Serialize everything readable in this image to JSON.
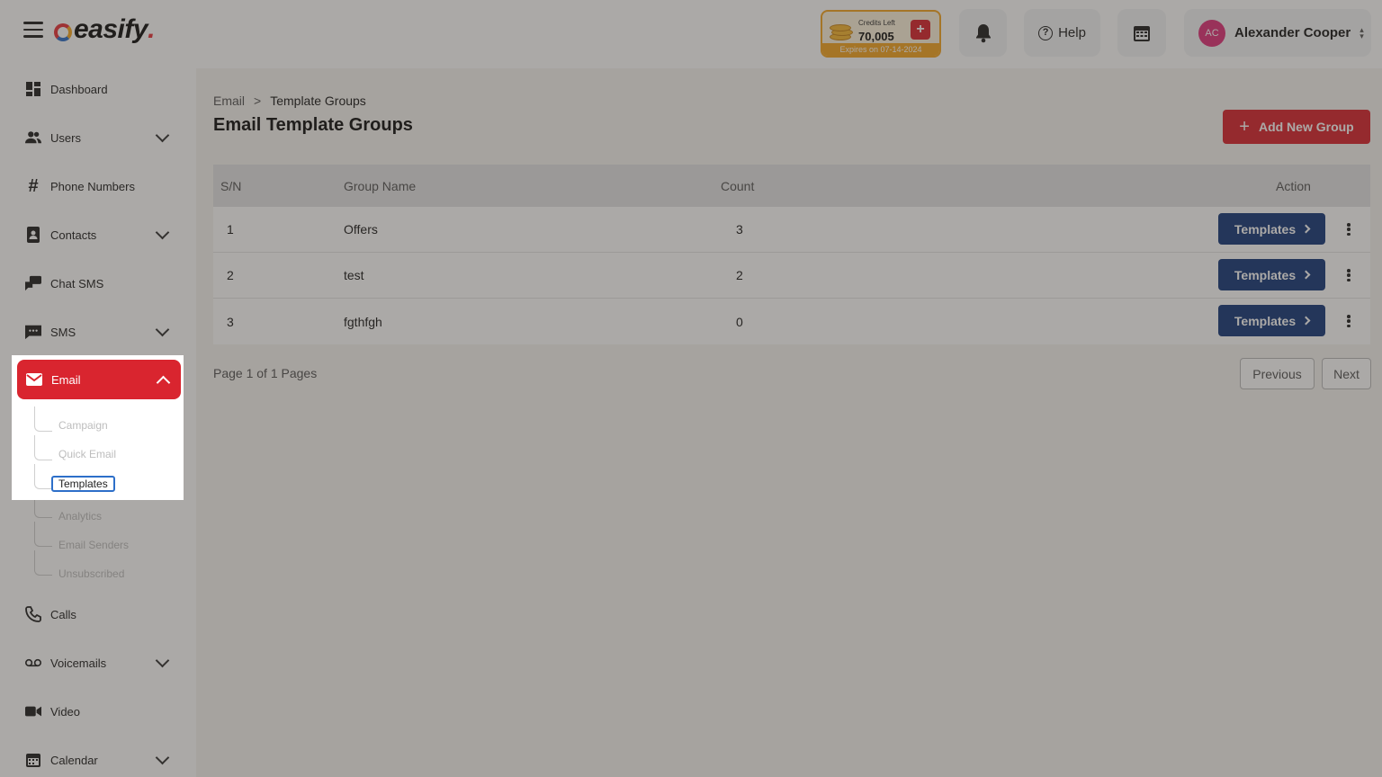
{
  "header": {
    "logo_text": "easify",
    "credits": {
      "label": "Credits Left",
      "amount": "70,005",
      "expires": "Expires on 07-14-2024",
      "add_symbol": "+"
    },
    "help_label": "Help",
    "user": {
      "initials": "AC",
      "name": "Alexander Cooper"
    },
    "colors": {
      "brand_red": "#d9252f",
      "credits_orange": "#f5a524",
      "avatar_pink": "#e0327a"
    }
  },
  "sidebar": {
    "items": [
      {
        "label": "Dashboard",
        "icon": "dashboard-icon",
        "expandable": false
      },
      {
        "label": "Users",
        "icon": "users-icon",
        "expandable": true
      },
      {
        "label": "Phone Numbers",
        "icon": "hash-icon",
        "expandable": false
      },
      {
        "label": "Contacts",
        "icon": "contacts-icon",
        "expandable": true
      },
      {
        "label": "Chat SMS",
        "icon": "chat-icon",
        "expandable": false
      },
      {
        "label": "SMS",
        "icon": "sms-icon",
        "expandable": true
      },
      {
        "label": "Email",
        "icon": "mail-icon",
        "expandable": true,
        "active": true
      },
      {
        "label": "Calls",
        "icon": "phone-icon",
        "expandable": false
      },
      {
        "label": "Voicemails",
        "icon": "voicemail-icon",
        "expandable": true
      },
      {
        "label": "Video",
        "icon": "video-icon",
        "expandable": false
      },
      {
        "label": "Calendar",
        "icon": "calendar-icon",
        "expandable": true
      }
    ],
    "email_subitems": [
      "Campaign",
      "Quick Email",
      "Templates",
      "Analytics",
      "Email Senders",
      "Unsubscribed"
    ],
    "selected_subitem": "Templates"
  },
  "main": {
    "breadcrumb": {
      "parent": "Email",
      "separator": ">",
      "current": "Template Groups"
    },
    "title": "Email Template Groups",
    "add_button": {
      "symbol": "+",
      "label": "Add New Group"
    },
    "table": {
      "columns": [
        "S/N",
        "Group Name",
        "Count",
        "Action"
      ],
      "rows": [
        {
          "sn": "1",
          "name": "Offers",
          "count": "3",
          "action": "Templates"
        },
        {
          "sn": "2",
          "name": "test",
          "count": "2",
          "action": "Templates"
        },
        {
          "sn": "3",
          "name": "fgthfgh",
          "count": "0",
          "action": "Templates"
        }
      ]
    },
    "pagination": {
      "info": "Page 1 of 1 Pages",
      "previous": "Previous",
      "next": "Next"
    }
  }
}
